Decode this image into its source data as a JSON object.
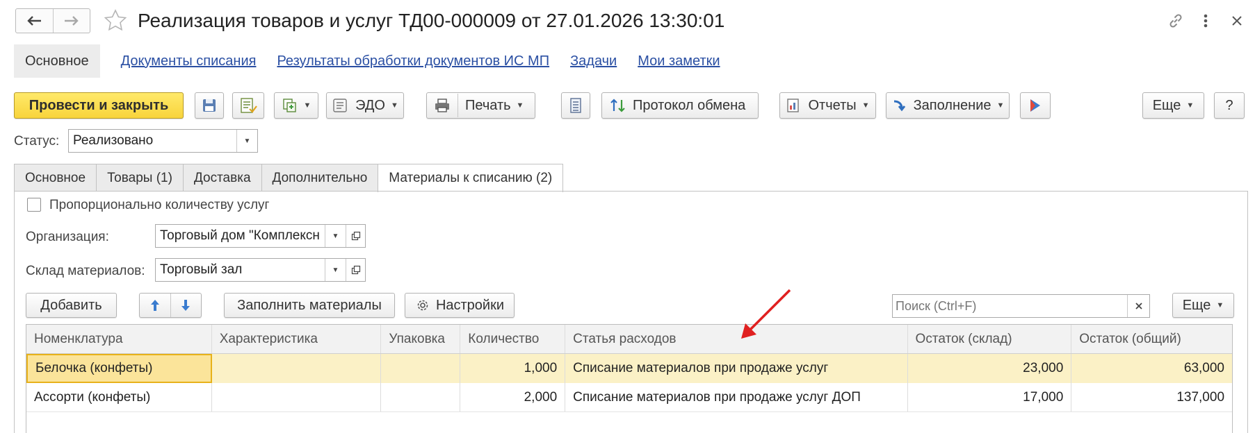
{
  "title": "Реализация товаров и услуг ТД00-000009 от 27.01.2026 13:30:01",
  "section_nav": {
    "active": "Основное",
    "links": [
      "Документы списания",
      "Результаты обработки документов ИС МП",
      "Задачи",
      "Мои заметки"
    ]
  },
  "toolbar": {
    "post_close": "Провести и закрыть",
    "edo": "ЭДО",
    "print": "Печать",
    "exchange_log": "Протокол обмена",
    "reports": "Отчеты",
    "fill": "Заполнение",
    "more": "Еще",
    "help": "?"
  },
  "status": {
    "label": "Статус:",
    "value": "Реализовано"
  },
  "tabs": [
    "Основное",
    "Товары (1)",
    "Доставка",
    "Дополнительно",
    "Материалы к списанию (2)"
  ],
  "materials": {
    "proportional_label": "Пропорционально количеству услуг",
    "proportional_checked": false,
    "org_label": "Организация:",
    "org_value": "Торговый дом \"Комплексн",
    "warehouse_label": "Склад материалов:",
    "warehouse_value": "Торговый зал",
    "add_btn": "Добавить",
    "fill_btn": "Заполнить материалы",
    "settings_btn": "Настройки",
    "search_placeholder": "Поиск (Ctrl+F)",
    "more_btn": "Еще",
    "columns": [
      "Номенклатура",
      "Характеристика",
      "Упаковка",
      "Количество",
      "Статья расходов",
      "Остаток (склад)",
      "Остаток (общий)"
    ],
    "rows": [
      [
        "Белочка (конфеты)",
        "",
        "",
        "1,000",
        "Списание материалов при продаже услуг",
        "23,000",
        "63,000"
      ],
      [
        "Ассорти (конфеты)",
        "",
        "",
        "2,000",
        "Списание материалов при продаже услуг ДОП",
        "17,000",
        "137,000"
      ]
    ]
  },
  "colors": {
    "primary_button": "#f8d43c",
    "link": "#2a4fa3",
    "selected_row": "#fbf1c6",
    "arrow": "#e02020"
  }
}
